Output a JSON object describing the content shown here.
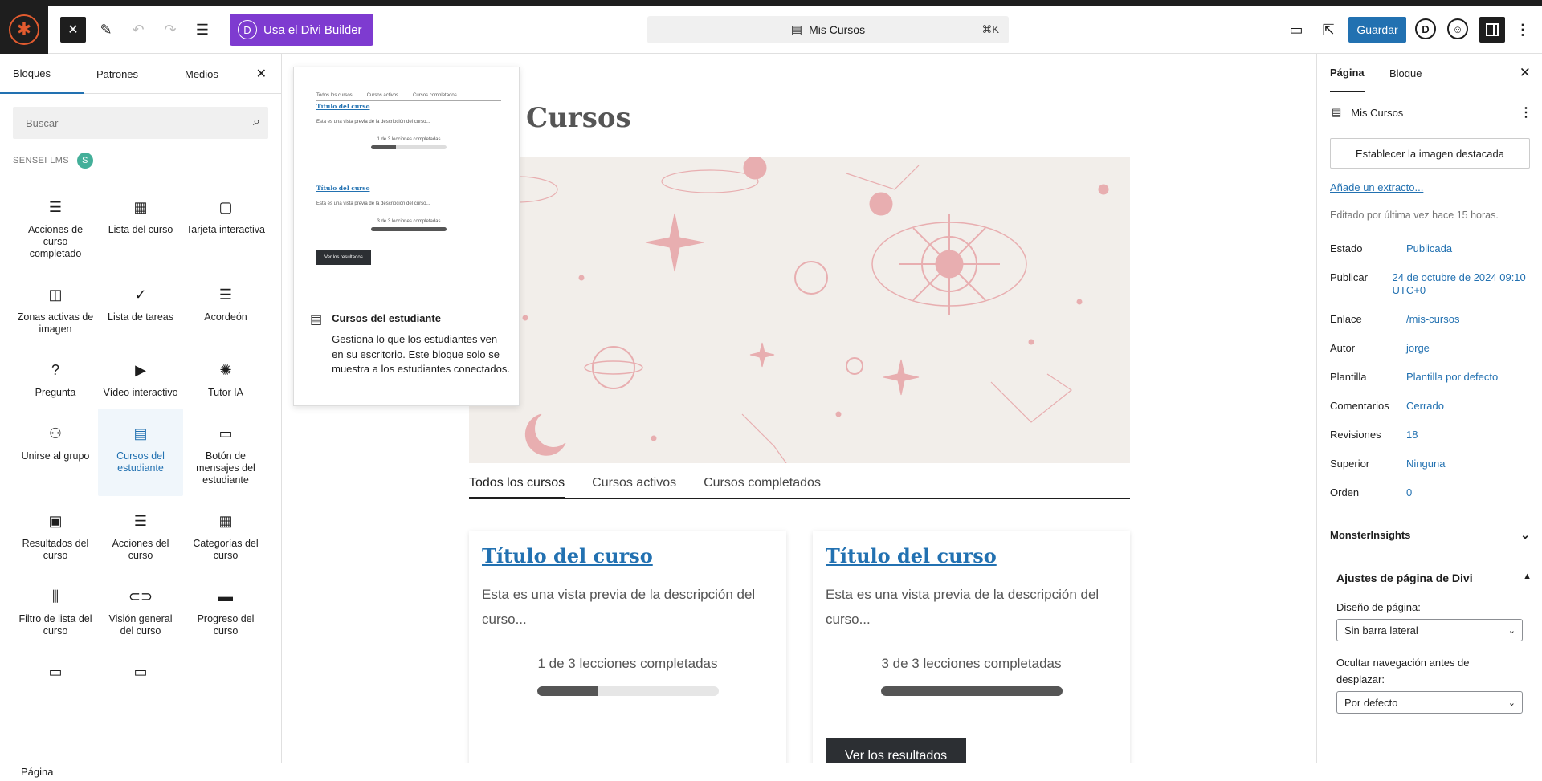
{
  "toolbar": {
    "divi_button_label": "Usa el Divi Builder",
    "divi_letter": "D",
    "document_title": "Mis Cursos",
    "shortcut": "⌘K",
    "save_label": "Guardar",
    "divi_circle_letter": "D"
  },
  "inserter": {
    "tabs": [
      "Bloques",
      "Patrones",
      "Medios"
    ],
    "search_placeholder": "Buscar",
    "category": "SENSEI LMS",
    "blocks": [
      {
        "label": "Acciones de curso completado",
        "icon": "course-actions-icon",
        "glyph": "☰"
      },
      {
        "label": "Lista del curso",
        "icon": "course-list-icon",
        "glyph": "▦"
      },
      {
        "label": "Tarjeta interactiva",
        "icon": "flashcard-icon",
        "glyph": "▢"
      },
      {
        "label": "Zonas activas de imagen",
        "icon": "image-hotspots-icon",
        "glyph": "◫"
      },
      {
        "label": "Lista de tareas",
        "icon": "tasklist-icon",
        "glyph": "✓"
      },
      {
        "label": "Acordeón",
        "icon": "accordion-icon",
        "glyph": "☰"
      },
      {
        "label": "Pregunta",
        "icon": "question-icon",
        "glyph": "?"
      },
      {
        "label": "Vídeo interactivo",
        "icon": "interactive-video-icon",
        "glyph": "▶"
      },
      {
        "label": "Tutor IA",
        "icon": "ai-tutor-icon",
        "glyph": "✺"
      },
      {
        "label": "Unirse al grupo",
        "icon": "join-group-icon",
        "glyph": "⚇"
      },
      {
        "label": "Cursos del estudiante",
        "icon": "learner-courses-icon",
        "glyph": "▤",
        "selected": true
      },
      {
        "label": "Botón de mensajes del estudiante",
        "icon": "learner-messages-button-icon",
        "glyph": "▭"
      },
      {
        "label": "Resultados del curso",
        "icon": "course-results-icon",
        "glyph": "▣"
      },
      {
        "label": "Acciones del curso",
        "icon": "course-actions-icon",
        "glyph": "☰"
      },
      {
        "label": "Categorías del curso",
        "icon": "course-categories-icon",
        "glyph": "▦"
      },
      {
        "label": "Filtro de lista del curso",
        "icon": "course-list-filter-icon",
        "glyph": "⫼"
      },
      {
        "label": "Visión general del curso",
        "icon": "course-overview-icon",
        "glyph": "⊂⊃"
      },
      {
        "label": "Progreso del curso",
        "icon": "course-progress-icon",
        "glyph": "▬"
      },
      {
        "label": "",
        "icon": "button-icon",
        "glyph": "▭"
      },
      {
        "label": "",
        "icon": "button-icon",
        "glyph": "▭"
      }
    ]
  },
  "preview": {
    "tabs": [
      "Todos los cursos",
      "Cursos activos",
      "Cursos completados"
    ],
    "course_title": "Título del curso",
    "course_desc": "Esta es una vista previa de la descripción del curso...",
    "progress_1": "1 de 3 lecciones completadas",
    "progress_2": "3 de 3 lecciones completadas",
    "button": "Ver los resultados",
    "block_name": "Cursos del estudiante",
    "block_desc": "Gestiona lo que los estudiantes ven en su escritorio. Este bloque solo se muestra a los estudiantes conectados."
  },
  "canvas": {
    "page_title": "Cursos",
    "tabs": [
      "Todos los cursos",
      "Cursos activos",
      "Cursos completados"
    ],
    "cards": [
      {
        "title": "Título del curso",
        "desc": "Esta es una vista previa de la descripción del curso...",
        "progress_text": "1 de 3 lecciones completadas",
        "progress": 0.333,
        "button": ""
      },
      {
        "title": "Título del curso",
        "desc": "Esta es una vista previa de la descripción del curso...",
        "progress_text": "3 de 3 lecciones completadas",
        "progress": 1.0,
        "button": "Ver los resultados"
      }
    ]
  },
  "settings": {
    "tabs": [
      "Página",
      "Bloque"
    ],
    "doc_title": "Mis Cursos",
    "featured_image_button": "Establecer la imagen destacada",
    "excerpt_link": "Añade un extracto...",
    "edited": "Editado por última vez hace 15 horas.",
    "meta": [
      {
        "key": "Estado",
        "value": "Publicada"
      },
      {
        "key": "Publicar",
        "value": "24 de octubre de 2024 09:10 UTC+0"
      },
      {
        "key": "Enlace",
        "value": "/mis-cursos"
      },
      {
        "key": "Autor",
        "value": "jorge"
      },
      {
        "key": "Plantilla",
        "value": "Plantilla por defecto"
      },
      {
        "key": "Comentarios",
        "value": "Cerrado"
      },
      {
        "key": "Revisiones",
        "value": "18"
      },
      {
        "key": "Superior",
        "value": "Ninguna"
      },
      {
        "key": "Orden",
        "value": "0"
      }
    ],
    "monsterinsights": "MonsterInsights",
    "divi_panel_title": "Ajustes de página de Divi",
    "layout_label": "Diseño de página:",
    "layout_value": "Sin barra lateral",
    "hide_nav_label": "Ocultar navegación antes de desplazar:",
    "hide_nav_value": "Por defecto"
  },
  "footer": {
    "breadcrumb": "Página"
  }
}
